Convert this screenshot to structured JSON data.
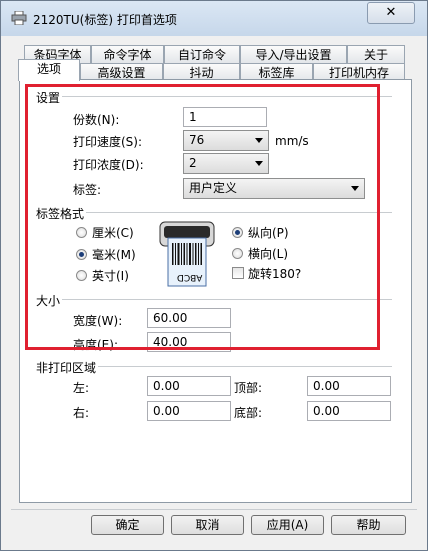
{
  "window": {
    "title": "2120TU(标签) 打印首选项",
    "close_glyph": "✕"
  },
  "tabs_row1": [
    "条码字体",
    "命令字体",
    "自订命令",
    "导入/导出设置",
    "关于"
  ],
  "tabs_row2": [
    "选项",
    "高级设置",
    "抖动",
    "标签库",
    "打印机内存"
  ],
  "settings": {
    "group_label": "设置",
    "copies_label": "份数(N):",
    "copies_value": "1",
    "speed_label": "打印速度(S):",
    "speed_value": "76",
    "speed_unit": "mm/s",
    "darkness_label": "打印浓度(D):",
    "darkness_value": "2",
    "label_label": "标签:",
    "label_value": "用户定义"
  },
  "label_format": {
    "group_label": "标签格式",
    "units": {
      "cm": "厘米(C)",
      "mm": "毫米(M)",
      "inch": "英寸(I)",
      "selected": "mm"
    },
    "orientation": {
      "portrait": "纵向(P)",
      "landscape": "横向(L)",
      "selected": "portrait"
    },
    "rotate_label": "旋转180?",
    "rotate_checked": false,
    "preview_text": "ABCD"
  },
  "size": {
    "group_label": "大小",
    "width_label": "宽度(W):",
    "width_value": "60.00",
    "height_label": "高度(E):",
    "height_value": "40.00"
  },
  "unprintable": {
    "group_label": "非打印区域",
    "left_label": "左:",
    "left_value": "0.00",
    "top_label": "顶部:",
    "top_value": "0.00",
    "right_label": "右:",
    "right_value": "0.00",
    "bottom_label": "底部:",
    "bottom_value": "0.00"
  },
  "buttons": {
    "ok": "确定",
    "cancel": "取消",
    "apply": "应用(A)",
    "help": "帮助"
  },
  "colors": {
    "highlight_border": "#e02030",
    "radio_dot": "#1c3d78"
  }
}
